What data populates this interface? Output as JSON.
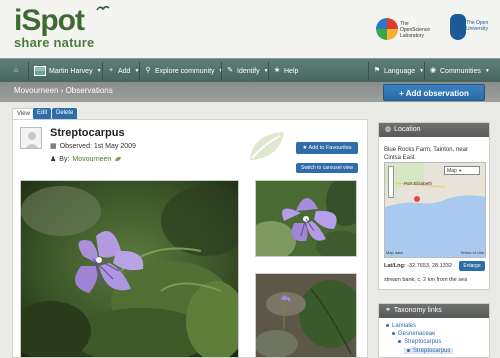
{
  "brand": {
    "name": "iSpot",
    "tagline": "share nature",
    "partner1": "The OpenScience Laboratory",
    "partner2": "The Open University"
  },
  "nav": {
    "home_icon": "home-icon",
    "user": "Martin Harvey",
    "add": "Add",
    "explore": "Explore community",
    "identify": "Identify",
    "help": "Help",
    "language": "Language",
    "communities": "Communities"
  },
  "breadcrumb": "Movourneen › Observations",
  "add_observation": "Add observation",
  "tabs": [
    "View",
    "Edit",
    "Delete"
  ],
  "observation": {
    "title": "Streptocarpus",
    "observed": "Observed: 1st May 2009",
    "by_label": "By:",
    "user": "Movourneen",
    "favourites": "Add to Favourites",
    "carousel": "Switch to carousel view"
  },
  "location": {
    "heading": "Location",
    "place": "Blue Rocks Farm, Tainton, near Cintsa East",
    "map_type": "Map",
    "map_city": "Port Elizabeth",
    "map_data": "Map data",
    "terms": "Terms of Use",
    "latlng_label": "Lat/Lng:",
    "latlng_value": "-32.7653, 28.1332",
    "enlarge": "Enlarge",
    "note": "stream bank, c. 2 km from the sea"
  },
  "taxonomy": {
    "heading": "Taxonomy links",
    "items": [
      "Lamiales",
      "Gesneriaceae",
      "Streptocarpus",
      "Streptocarpus"
    ]
  }
}
